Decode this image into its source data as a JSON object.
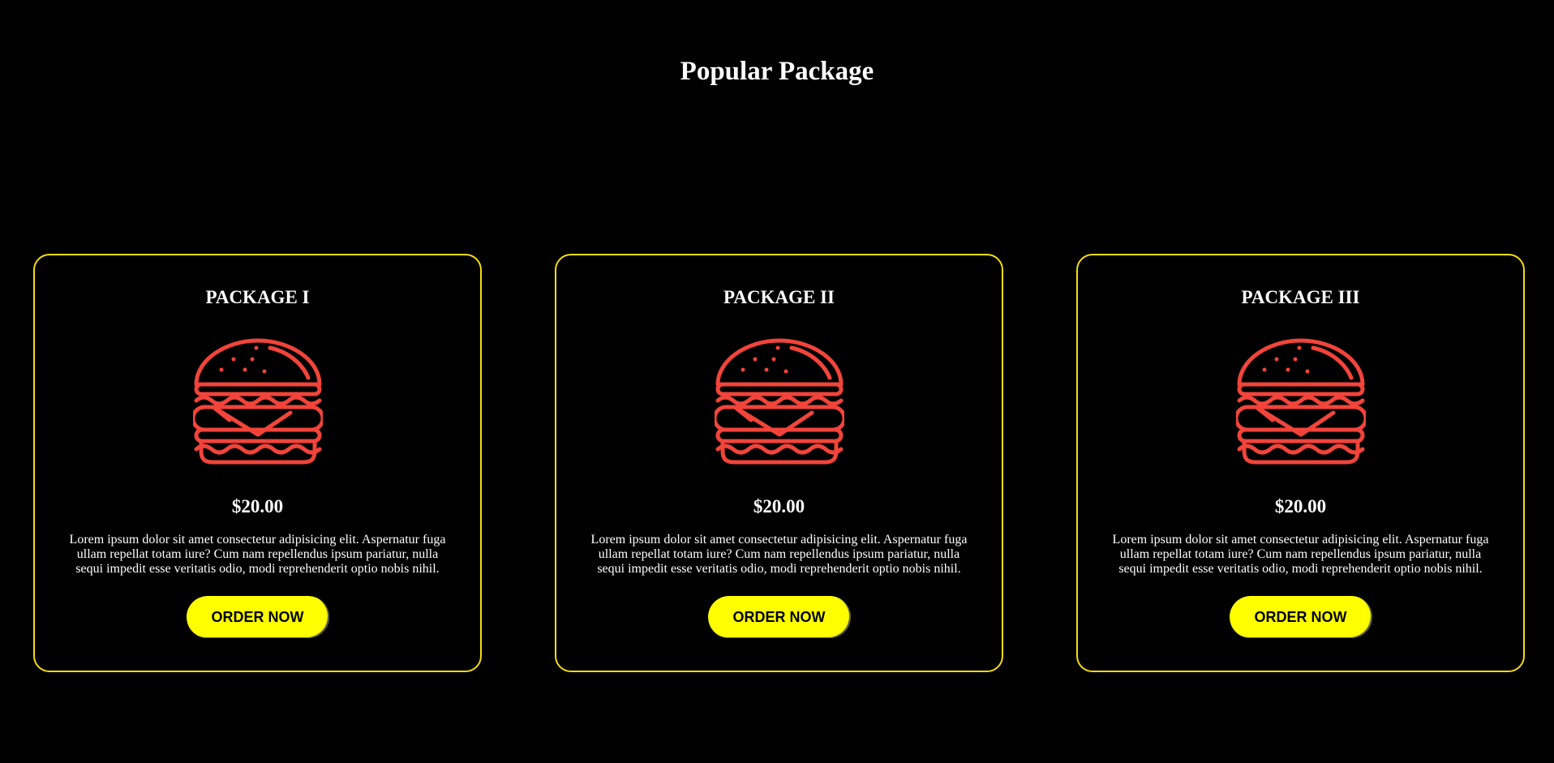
{
  "section": {
    "title": "Popular Package"
  },
  "colors": {
    "background": "#000000",
    "card_border": "#f5dc12",
    "button": "#ffff00",
    "icon": "#f2443a",
    "text": "#ffffff"
  },
  "packages": [
    {
      "title": "PACKAGE I",
      "icon": "burger-icon",
      "price": "$20.00",
      "description": "Lorem ipsum dolor sit amet consectetur adipisicing elit. Aspernatur fuga ullam repellat totam iure? Cum nam repellendus ipsum pariatur, nulla sequi impedit esse veritatis odio, modi reprehenderit optio nobis nihil.",
      "button_label": "ORDER NOW"
    },
    {
      "title": "PACKAGE II",
      "icon": "burger-icon",
      "price": "$20.00",
      "description": "Lorem ipsum dolor sit amet consectetur adipisicing elit. Aspernatur fuga ullam repellat totam iure? Cum nam repellendus ipsum pariatur, nulla sequi impedit esse veritatis odio, modi reprehenderit optio nobis nihil.",
      "button_label": "ORDER NOW"
    },
    {
      "title": "PACKAGE III",
      "icon": "burger-icon",
      "price": "$20.00",
      "description": "Lorem ipsum dolor sit amet consectetur adipisicing elit. Aspernatur fuga ullam repellat totam iure? Cum nam repellendus ipsum pariatur, nulla sequi impedit esse veritatis odio, modi reprehenderit optio nobis nihil.",
      "button_label": "ORDER NOW"
    }
  ]
}
